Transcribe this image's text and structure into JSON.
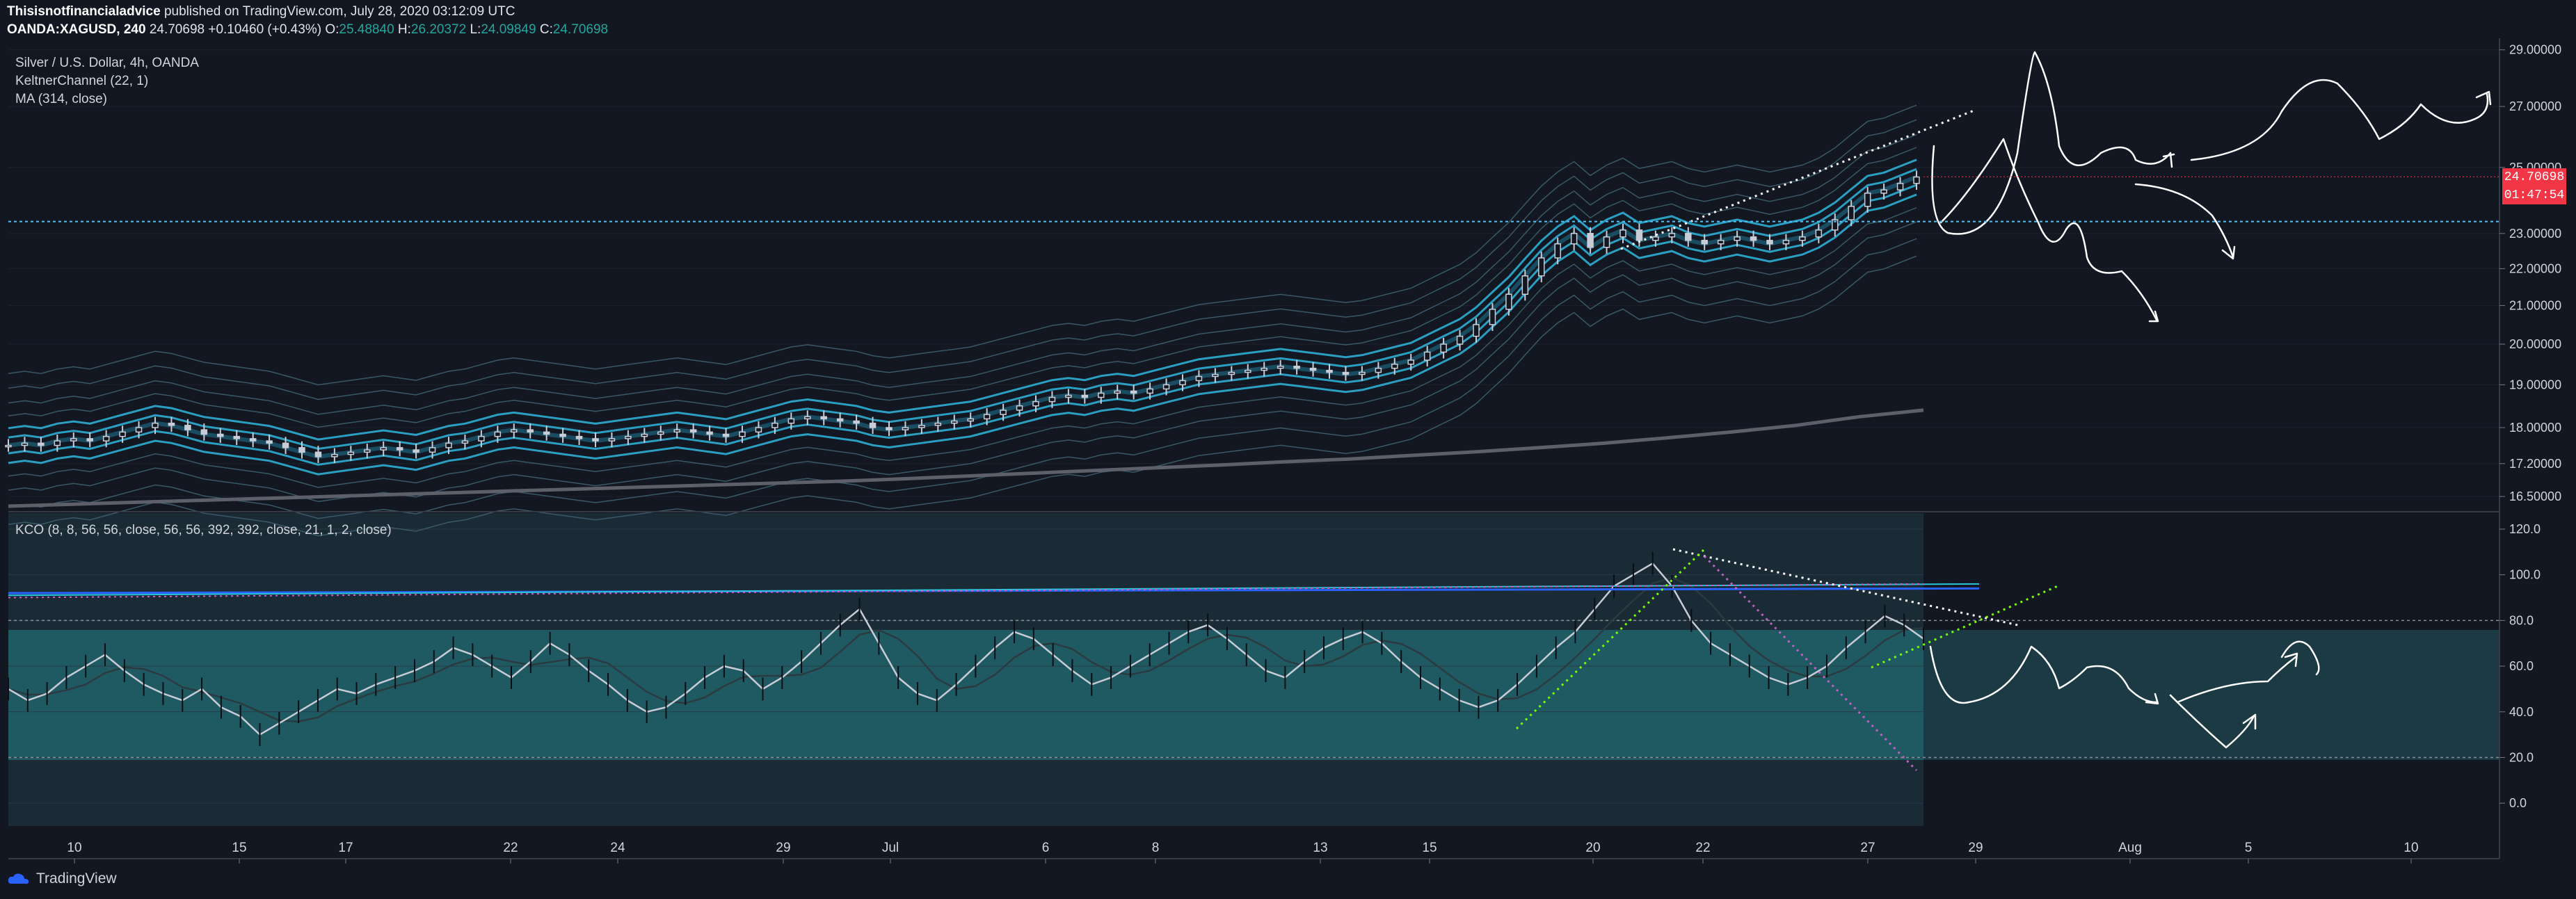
{
  "header": {
    "author": "Thisisnotfinancialadvice",
    "published_text": " published on TradingView.com, July 28, 2020 03:12:09 UTC",
    "symbol": "OANDA:XAGUSD, 240",
    "last": "24.70698",
    "change": "+0.10460 (+0.43%)",
    "o_label": "O:",
    "o": "25.48840",
    "h_label": "H:",
    "h": "26.20372",
    "l_label": "L:",
    "l": "24.09849",
    "c_label": "C:",
    "c": "24.70698"
  },
  "legend": {
    "title": "Silver / U.S. Dollar, 4h, OANDA",
    "ind1": "KeltnerChannel (22, 1)",
    "ind2": "MA (314, close)"
  },
  "kco_legend": "KCO (8, 8, 56, 56, close, 56, 56, 392, 392, close, 21, 1, 2, close)",
  "price_badge": "24.70698",
  "countdown_badge": "01:47:54",
  "footer": {
    "brand": "TradingView"
  },
  "colors": {
    "background": "#131722",
    "candle": "#d1d4dc",
    "keltner": "#1e88a8",
    "ma": "#555a66",
    "kco_fill": "#1f5a63",
    "marker": "#f23645"
  },
  "chart_data": [
    {
      "type": "line",
      "title": "Silver / U.S. Dollar, 4h, OANDA",
      "x_ticks": [
        "10",
        "15",
        "17",
        "22",
        "24",
        "29",
        "Jul",
        "6",
        "8",
        "13",
        "15",
        "20",
        "22",
        "27",
        "29",
        "Aug",
        "5",
        "10"
      ],
      "y_ticks": [
        "29.00000",
        "27.00000",
        "25.00000",
        "23.00000",
        "22.00000",
        "21.00000",
        "20.00000",
        "19.00000",
        "18.00000",
        "17.20000",
        "16.50000"
      ],
      "y_scale": "log",
      "ylim": [
        16.2,
        29.3
      ],
      "horizontal_line": 23.35,
      "series": [
        {
          "name": "Close",
          "values": [
            17.6,
            17.65,
            17.6,
            17.7,
            17.75,
            17.7,
            17.8,
            17.9,
            18.0,
            18.1,
            18.05,
            17.95,
            17.85,
            17.8,
            17.75,
            17.7,
            17.65,
            17.55,
            17.45,
            17.35,
            17.4,
            17.45,
            17.5,
            17.55,
            17.5,
            17.45,
            17.55,
            17.65,
            17.7,
            17.8,
            17.9,
            17.95,
            17.9,
            17.85,
            17.8,
            17.75,
            17.7,
            17.75,
            17.8,
            17.85,
            17.9,
            17.95,
            17.9,
            17.85,
            17.8,
            17.9,
            18.0,
            18.1,
            18.2,
            18.25,
            18.2,
            18.15,
            18.1,
            18.0,
            17.95,
            18.0,
            18.05,
            18.1,
            18.15,
            18.2,
            18.3,
            18.4,
            18.5,
            18.6,
            18.7,
            18.75,
            18.7,
            18.8,
            18.85,
            18.8,
            18.9,
            19.0,
            19.1,
            19.2,
            19.25,
            19.3,
            19.35,
            19.4,
            19.45,
            19.4,
            19.35,
            19.3,
            19.25,
            19.3,
            19.4,
            19.5,
            19.6,
            19.8,
            20.0,
            20.2,
            20.5,
            20.9,
            21.3,
            21.8,
            22.3,
            22.7,
            23.0,
            22.6,
            22.9,
            23.1,
            22.8,
            22.9,
            23.0,
            22.8,
            22.7,
            22.8,
            22.9,
            22.8,
            22.7,
            22.8,
            22.9,
            23.1,
            23.4,
            23.8,
            24.2,
            24.3,
            24.5,
            24.7
          ]
        },
        {
          "name": "MA (314, close)",
          "values": [
            16.3,
            16.34,
            16.38,
            16.42,
            16.46,
            16.5,
            16.54,
            16.58,
            16.62,
            16.66,
            16.7,
            16.74,
            16.78,
            16.82,
            16.87,
            16.93,
            16.99,
            17.05,
            17.11,
            17.17,
            17.24,
            17.3,
            17.38,
            17.46,
            17.55,
            17.65,
            17.77,
            17.9,
            18.05,
            18.25,
            18.4
          ]
        }
      ]
    },
    {
      "type": "line",
      "title": "KCO (8, 8, 56, 56, close, 56, 56, 392, 392, close, 21, 1, 2, close)",
      "y_ticks": [
        "120.0",
        "100.0",
        "80.0",
        "60.0",
        "40.0",
        "20.0",
        "0.0"
      ],
      "ylim": [
        -10,
        127
      ],
      "bands": [
        20,
        80
      ],
      "series": [
        {
          "name": "KCO",
          "values": [
            50,
            45,
            48,
            55,
            60,
            65,
            58,
            52,
            48,
            45,
            50,
            42,
            38,
            30,
            35,
            40,
            45,
            50,
            48,
            52,
            55,
            58,
            62,
            68,
            65,
            60,
            55,
            62,
            70,
            65,
            58,
            52,
            45,
            40,
            42,
            48,
            55,
            60,
            58,
            50,
            55,
            62,
            70,
            78,
            85,
            70,
            55,
            48,
            45,
            52,
            60,
            68,
            75,
            72,
            65,
            58,
            52,
            55,
            60,
            65,
            70,
            75,
            78,
            72,
            65,
            58,
            55,
            62,
            68,
            72,
            75,
            70,
            62,
            55,
            50,
            45,
            42,
            45,
            52,
            60,
            68,
            75,
            85,
            95,
            100,
            105,
            95,
            80,
            70,
            65,
            60,
            55,
            52,
            55,
            60,
            68,
            75,
            82,
            78,
            72
          ]
        }
      ]
    }
  ]
}
